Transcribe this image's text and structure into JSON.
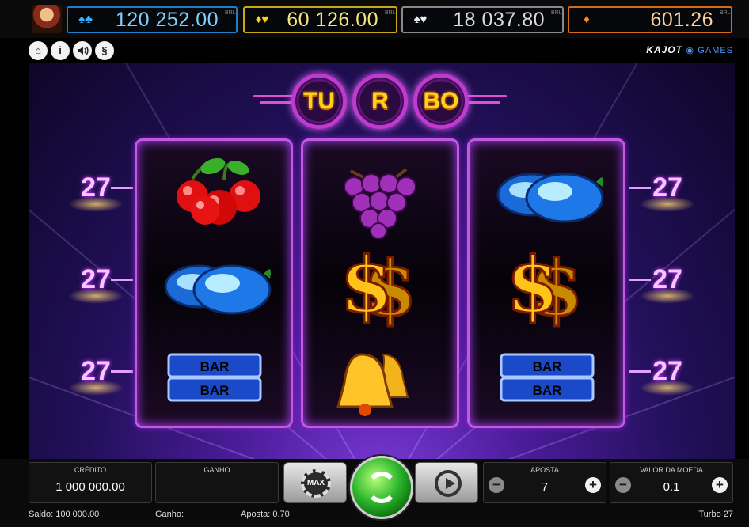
{
  "jackpots": [
    {
      "icon": "blue-cards-icon",
      "value": "120 252.00",
      "currency": "BRL",
      "color": "#1e7fc8"
    },
    {
      "icon": "gold-cards-icon",
      "value": "60 126.00",
      "currency": "BRL",
      "color": "#c8a814"
    },
    {
      "icon": "silver-cards-icon",
      "value": "18 037.80",
      "currency": "BRL",
      "color": "#8a8a8a"
    },
    {
      "icon": "orange-card-icon",
      "value": "601.26",
      "currency": "BRL",
      "color": "#d86a10"
    }
  ],
  "toolbar": {
    "home_icon": "⌂",
    "info_icon": "i",
    "sound_icon": "🔊",
    "rules_icon": "§"
  },
  "brand": {
    "name": "KAJOT",
    "suffix": "GAMES"
  },
  "title": {
    "letters": [
      "TU",
      "R",
      "BO"
    ]
  },
  "paylines": {
    "left": [
      "27",
      "27",
      "27"
    ],
    "right": [
      "27",
      "27",
      "27"
    ]
  },
  "reels": [
    [
      "cherries",
      "plums",
      "bar-double"
    ],
    [
      "grapes",
      "dollar",
      "bells"
    ],
    [
      "plums",
      "dollar",
      "bar-double"
    ]
  ],
  "bar_label": "BAR",
  "panel": {
    "credito_label": "CRÉDITO",
    "credito_value": "1 000 000.00",
    "ganho_label": "GANHO",
    "ganho_value": "",
    "max_label": "MAX",
    "aposta_label": "APOSTA",
    "aposta_value": "7",
    "moeda_label": "VALOR DA MOEDA",
    "moeda_value": "0.1",
    "minus": "−",
    "plus": "+"
  },
  "status": {
    "saldo": "Saldo: 100 000.00",
    "ganho": "Ganho:",
    "aposta": "Aposta: 0.70",
    "game": "Turbo 27"
  },
  "colors": {
    "reel_border": "#c25ae0",
    "title_gold": "#ffd21a",
    "spin_green": "#2eb82e"
  }
}
